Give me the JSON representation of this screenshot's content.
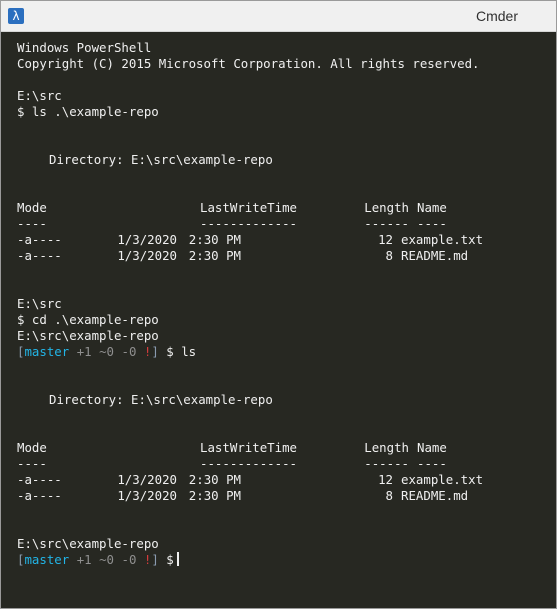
{
  "window": {
    "title": "Cmder",
    "app_icon": "cmder-lambda-icon"
  },
  "console": {
    "banner1": "Windows PowerShell",
    "banner2": "Copyright (C) 2015 Microsoft Corporation. All rights reserved.",
    "path1": "E:\\src",
    "cmd1": "$ ls .\\example-repo",
    "dir_label1": "Directory: E:\\src\\example-repo",
    "headers": {
      "mode": "Mode",
      "last": "LastWriteTime",
      "length": "Length",
      "name": "Name"
    },
    "dashes": {
      "mode": "----",
      "last": "-------------",
      "length": "------",
      "name": "----"
    },
    "listing1": [
      {
        "mode": "-a----",
        "date": "1/3/2020",
        "time": "2:30 PM",
        "length": "12",
        "name": "example.txt"
      },
      {
        "mode": "-a----",
        "date": "1/3/2020",
        "time": "2:30 PM",
        "length": "8",
        "name": "README.md"
      }
    ],
    "path2": "E:\\src",
    "cmd2": "$ cd .\\example-repo",
    "path3": "E:\\src\\example-repo",
    "git_prompt1": {
      "open": "[",
      "branch": "master",
      "ahead": "+1",
      "tilde": "~0",
      "minus": "-0",
      "bang": "!",
      "close": "]",
      "cmd": "$ ls"
    },
    "dir_label2": "Directory: E:\\src\\example-repo",
    "listing2": [
      {
        "mode": "-a----",
        "date": "1/3/2020",
        "time": "2:30 PM",
        "length": "12",
        "name": "example.txt"
      },
      {
        "mode": "-a----",
        "date": "1/3/2020",
        "time": "2:30 PM",
        "length": "8",
        "name": "README.md"
      }
    ],
    "path4": "E:\\src\\example-repo",
    "git_prompt2": {
      "open": "[",
      "branch": "master",
      "ahead": "+1",
      "tilde": "~0",
      "minus": "-0",
      "bang": "!",
      "close": "]",
      "cmd": "$"
    }
  },
  "colors": {
    "terminal_bg": "#272822",
    "text": "#f0f0f0",
    "branch": "#22b4e6",
    "muted": "#8f8f8f",
    "alert": "#d23b3b"
  }
}
